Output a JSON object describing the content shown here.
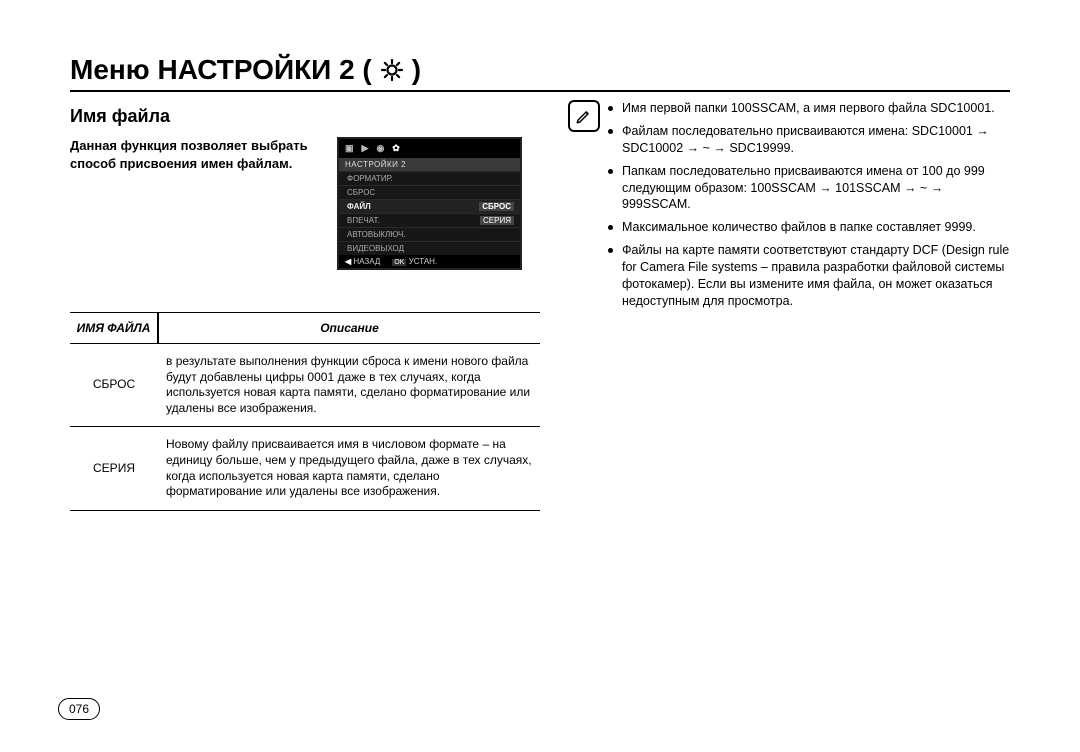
{
  "title_prefix": "Меню НАСТРОЙКИ 2 (",
  "title_suffix": ")",
  "icons": {
    "gear": "gear-icon",
    "pencil": "pencil-icon"
  },
  "left": {
    "heading": "Имя файла",
    "intro": "Данная функция позволяет выбрать способ присвоения имен файлам.",
    "lcd": {
      "tab_head": "НАСТРОЙКИ 2",
      "rows": [
        {
          "label": "ФОРМАТИР.",
          "value": ""
        },
        {
          "label": "СБРОС",
          "value": ""
        },
        {
          "label": "ФАЙЛ",
          "value": "СБРОС",
          "sel_left": true
        },
        {
          "label": "ВПЕЧАТ.",
          "value": "СЕРИЯ",
          "sel_right": true
        },
        {
          "label": "АВТОВЫКЛЮЧ.",
          "value": ""
        },
        {
          "label": "ВИДЕОВЫХОД",
          "value": ""
        }
      ],
      "back_arrow": "◀",
      "back_label": "НАЗАД",
      "ok_label": "OK",
      "set_label": "УСТАН."
    },
    "table": {
      "col1_head": "ИМЯ ФАЙЛА",
      "col2_head": "Описание",
      "rows": [
        {
          "mode": "СБРОС",
          "desc": "в результате выполнения функции сброса к имени нового файла будут добавлены цифры 0001 даже в тех случаях, когда используется новая карта памяти, сделано форматирование или удалены все изображения."
        },
        {
          "mode": "СЕРИЯ",
          "desc": "Новому файлу присваивается имя в числовом формате – на единицу больше, чем у предыдущего файла, даже в тех случаях, когда используется новая карта памяти, сделано форматирование или удалены все изображения."
        }
      ]
    }
  },
  "right": {
    "bullets": [
      "Имя первой папки 100SSCAM, а имя первого файла SDC10001.",
      "Файлам последовательно присваиваются имена: SDC10001 → SDC10002 → ~ → SDC19999.",
      "Папкам последовательно присваиваются имена от 100 до 999 следующим образом: 100SSCAM → 101SSCAM → ~ → 999SSCAM.",
      "Максимальное количество файлов в папке составляет 9999.",
      "Файлы на карте памяти соответствуют стандарту DCF (Design rule for Camera File systems – правила разработки файловой системы фотокамер). Если вы измените имя файла, он может оказаться недоступным для просмотра."
    ]
  },
  "page_number": "076"
}
